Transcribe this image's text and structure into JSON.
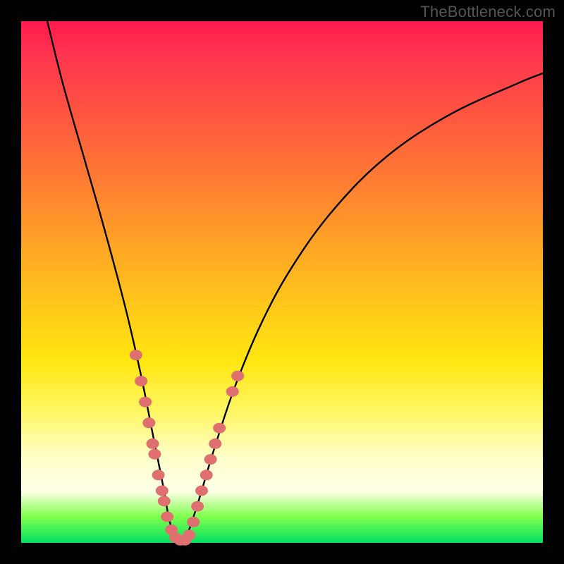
{
  "watermark": "TheBottleneck.com",
  "colors": {
    "frame": "#000000",
    "gradient_top": "#ff1a4d",
    "gradient_mid": "#ffc91a",
    "gradient_low": "#ffffcc",
    "gradient_bottom": "#00e060",
    "curve": "#000000",
    "marker_fill": "#e07070",
    "marker_stroke": "#c05858"
  },
  "chart_data": {
    "type": "line",
    "title": "",
    "xlabel": "",
    "ylabel": "",
    "xlim": [
      0,
      100
    ],
    "ylim": [
      0,
      100
    ],
    "note": "No axes or tick labels are rendered. Values below are estimated from pixel positions; y represents bottleneck % (0 = perfect match at the V-notch, 100 = top of chart).",
    "series": [
      {
        "name": "bottleneck-curve",
        "x": [
          5,
          8,
          12,
          16,
          20,
          23,
          25,
          27,
          28.5,
          30,
          31,
          32,
          34,
          37,
          41,
          46,
          52,
          60,
          70,
          82,
          95,
          100
        ],
        "y": [
          100,
          88,
          74,
          60,
          45,
          32,
          22,
          12,
          4,
          0,
          0,
          2,
          8,
          18,
          30,
          42,
          53,
          64,
          74,
          82,
          88,
          90
        ]
      }
    ],
    "markers": {
      "name": "highlighted-points",
      "comment": "Pink dot clusters along both branches near the valley",
      "points": [
        {
          "x": 22.0,
          "y": 36
        },
        {
          "x": 23.0,
          "y": 31
        },
        {
          "x": 23.8,
          "y": 27
        },
        {
          "x": 24.5,
          "y": 23
        },
        {
          "x": 25.2,
          "y": 19
        },
        {
          "x": 25.6,
          "y": 17
        },
        {
          "x": 26.3,
          "y": 13
        },
        {
          "x": 27.0,
          "y": 10
        },
        {
          "x": 27.4,
          "y": 8
        },
        {
          "x": 28.0,
          "y": 5
        },
        {
          "x": 28.8,
          "y": 2.5
        },
        {
          "x": 29.6,
          "y": 1
        },
        {
          "x": 30.5,
          "y": 0.5
        },
        {
          "x": 31.4,
          "y": 0.5
        },
        {
          "x": 32.2,
          "y": 1.5
        },
        {
          "x": 33.0,
          "y": 4
        },
        {
          "x": 33.8,
          "y": 7
        },
        {
          "x": 34.6,
          "y": 10
        },
        {
          "x": 35.5,
          "y": 13
        },
        {
          "x": 36.3,
          "y": 16
        },
        {
          "x": 37.2,
          "y": 19
        },
        {
          "x": 38.0,
          "y": 22
        },
        {
          "x": 40.5,
          "y": 29
        },
        {
          "x": 41.5,
          "y": 32
        }
      ]
    }
  }
}
